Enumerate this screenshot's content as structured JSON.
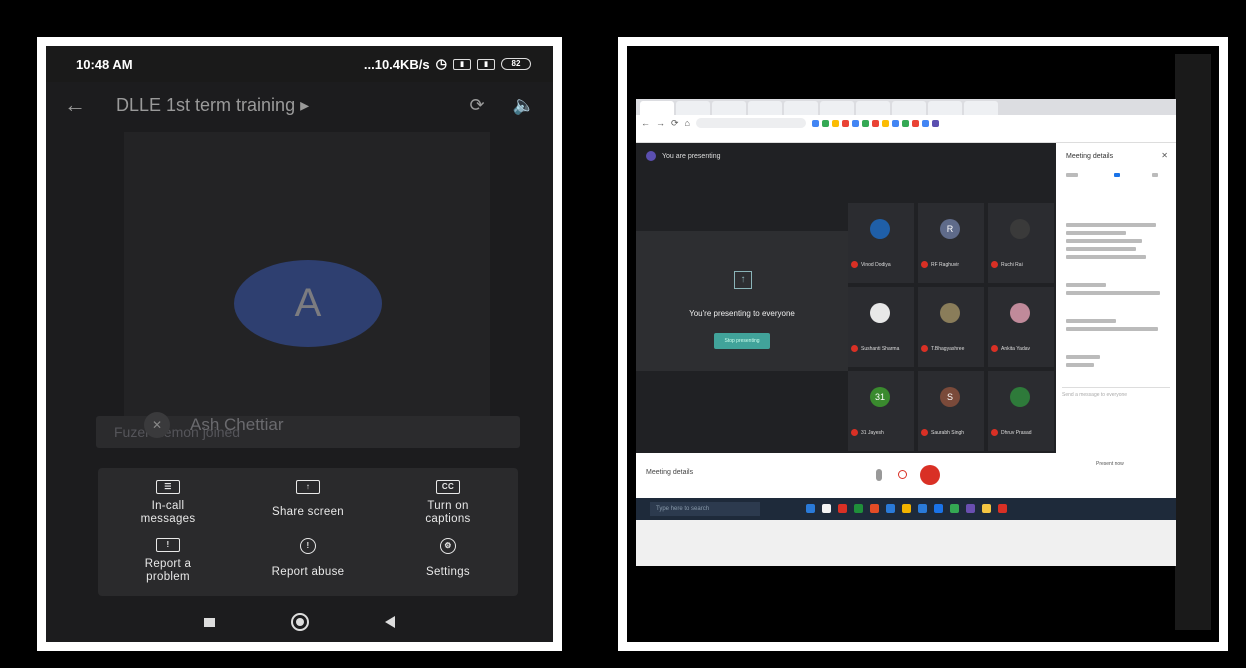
{
  "phone": {
    "time": "10:48 AM",
    "net_speed": "...10.4KB/s",
    "battery": "82",
    "meeting_title": "DLLE 1st term training",
    "avatar_letter": "A",
    "join_toast": "Fuzel Memon joined",
    "participant_name": "Ash Chettiar",
    "options": [
      {
        "label": "In-call\nmessages",
        "icon": "chat-icon"
      },
      {
        "label": "Share screen",
        "icon": "share-screen-icon"
      },
      {
        "label": "Turn on\ncaptions",
        "icon": "captions-icon"
      },
      {
        "label": "Report a\nproblem",
        "icon": "report-problem-icon"
      },
      {
        "label": "Report abuse",
        "icon": "report-abuse-icon"
      },
      {
        "label": "Settings",
        "icon": "settings-icon"
      }
    ]
  },
  "desktop": {
    "presenting_banner": "You are presenting",
    "presenting_message": "You're presenting to everyone",
    "stop_presenting": "Stop presenting",
    "details_title": "Meeting details",
    "meeting_details_label": "Meeting details",
    "send_message_placeholder": "Send a message to everyone",
    "present_now": "Present now",
    "search_placeholder": "Type here to search",
    "participants": [
      {
        "initial": "",
        "color": "#1f5fa8",
        "name": "Vinod Dodiya"
      },
      {
        "initial": "R",
        "color": "#5f6b8a",
        "name": "RF Raghuvir"
      },
      {
        "initial": "",
        "color": "#3a3a3a",
        "name": "Ruchi Rai"
      },
      {
        "initial": "",
        "color": "#e8e8e8",
        "name": "Sushanti Sharma"
      },
      {
        "initial": "",
        "color": "#8a7d5a",
        "name": "T.Bhagyashree"
      },
      {
        "initial": "",
        "color": "#c08a9a",
        "name": "Ankita Yadav"
      },
      {
        "initial": "31",
        "color": "#3a8a2e",
        "name": "31 Jayesh"
      },
      {
        "initial": "S",
        "color": "#7a4a3a",
        "name": "Saurabh Singh"
      },
      {
        "initial": "",
        "color": "#2e7a3a",
        "name": "Dhruv Prasad"
      }
    ]
  }
}
